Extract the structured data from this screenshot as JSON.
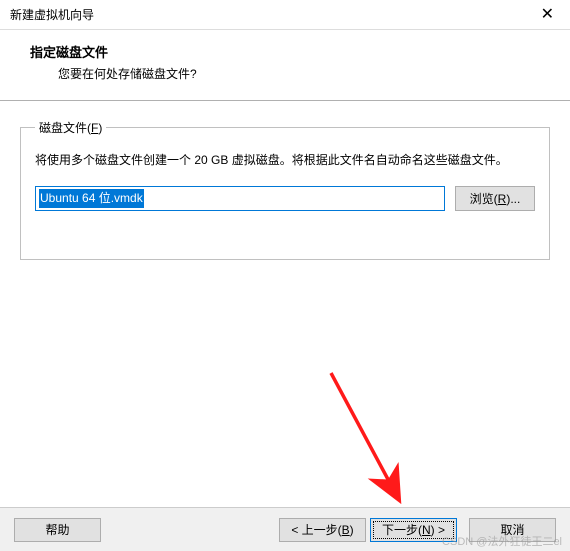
{
  "titlebar": {
    "title": "新建虚拟机向导",
    "close_glyph": "✕"
  },
  "header": {
    "heading": "指定磁盘文件",
    "subheading": "您要在何处存储磁盘文件?"
  },
  "group": {
    "legend": "磁盘文件(F)",
    "legend_key": "F",
    "description": "将使用多个磁盘文件创建一个 20 GB 虚拟磁盘。将根据此文件名自动命名这些磁盘文件。",
    "file_value": "Ubuntu 64 位.vmdk",
    "browse_label": "浏览(R)...",
    "browse_key": "R"
  },
  "footer": {
    "help": "帮助",
    "back": "< 上一步(B)",
    "back_key": "B",
    "next": "下一步(N) >",
    "next_key": "N",
    "cancel": "取消"
  },
  "watermark": "CSDN @法外狂徒王二el",
  "arrow": {
    "color": "#ff1a1a"
  }
}
